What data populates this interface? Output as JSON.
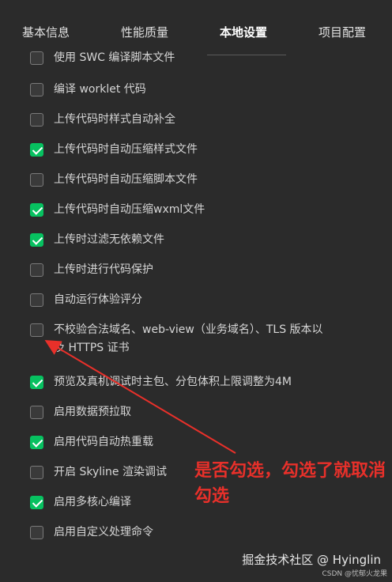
{
  "tabs": [
    {
      "label": "基本信息",
      "active": false
    },
    {
      "label": "性能质量",
      "active": false
    },
    {
      "label": "本地设置",
      "active": true
    },
    {
      "label": "项目配置",
      "active": false
    }
  ],
  "settings": [
    {
      "label": "使用 SWC 编译脚本文件",
      "checked": false
    },
    {
      "label": "编译 worklet 代码",
      "checked": false
    },
    {
      "label": "上传代码时样式自动补全",
      "checked": false
    },
    {
      "label": "上传代码时自动压缩样式文件",
      "checked": true
    },
    {
      "label": "上传代码时自动压缩脚本文件",
      "checked": false
    },
    {
      "label": "上传代码时自动压缩wxml文件",
      "checked": true
    },
    {
      "label": "上传时过滤无依赖文件",
      "checked": true
    },
    {
      "label": "上传时进行代码保护",
      "checked": false
    },
    {
      "label": "自动运行体验评分",
      "checked": false
    },
    {
      "label": "不校验合法域名、web-view（业务域名）、TLS 版本以及 HTTPS 证书",
      "checked": false
    },
    {
      "label": "预览及真机调试时主包、分包体积上限调整为4M",
      "checked": true
    },
    {
      "label": "启用数据预拉取",
      "checked": false
    },
    {
      "label": "启用代码自动热重载",
      "checked": true
    },
    {
      "label": "开启 Skyline 渲染调试",
      "checked": false
    },
    {
      "label": "启用多核心编译",
      "checked": true
    },
    {
      "label": "启用自定义处理命令",
      "checked": false
    }
  ],
  "annotation": {
    "text": "是否勾选，勾选了就取消勾选",
    "color": "#e8302a"
  },
  "watermark": "掘金技术社区 @ Hyinglin",
  "csdn_watermark": "CSDN @忧郁火龙果",
  "colors": {
    "background": "#2b2b2b",
    "checkbox_checked": "#07c160"
  }
}
